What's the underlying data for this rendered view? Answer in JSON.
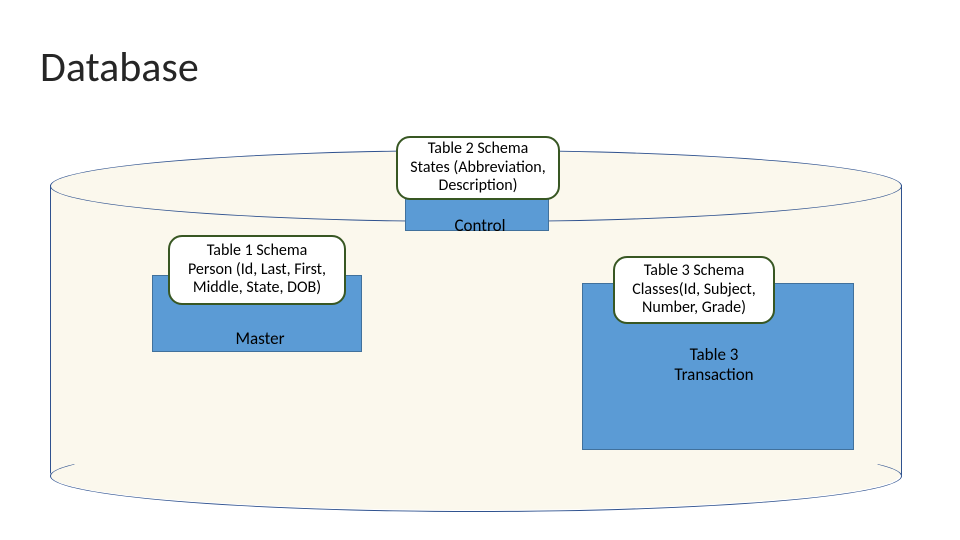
{
  "title": "Database",
  "cylinder": {
    "schemas": {
      "top": {
        "name": "table-2-schema",
        "line1": "Table 2 Schema",
        "line2": "States (Abbreviation,",
        "line3": "Description)"
      },
      "left": {
        "name": "table-1-schema",
        "line1": "Table 1 Schema",
        "line2": "Person (Id, Last, First,",
        "line3": "Middle, State, DOB)"
      },
      "right": {
        "name": "table-3-schema",
        "line1": "Table 3 Schema",
        "line2": "Classes(Id, Subject,",
        "line3": "Number, Grade)"
      }
    },
    "labels": {
      "control": "Control",
      "master": "Master",
      "transaction_line1": "Table 3",
      "transaction_line2": "Transaction"
    }
  }
}
